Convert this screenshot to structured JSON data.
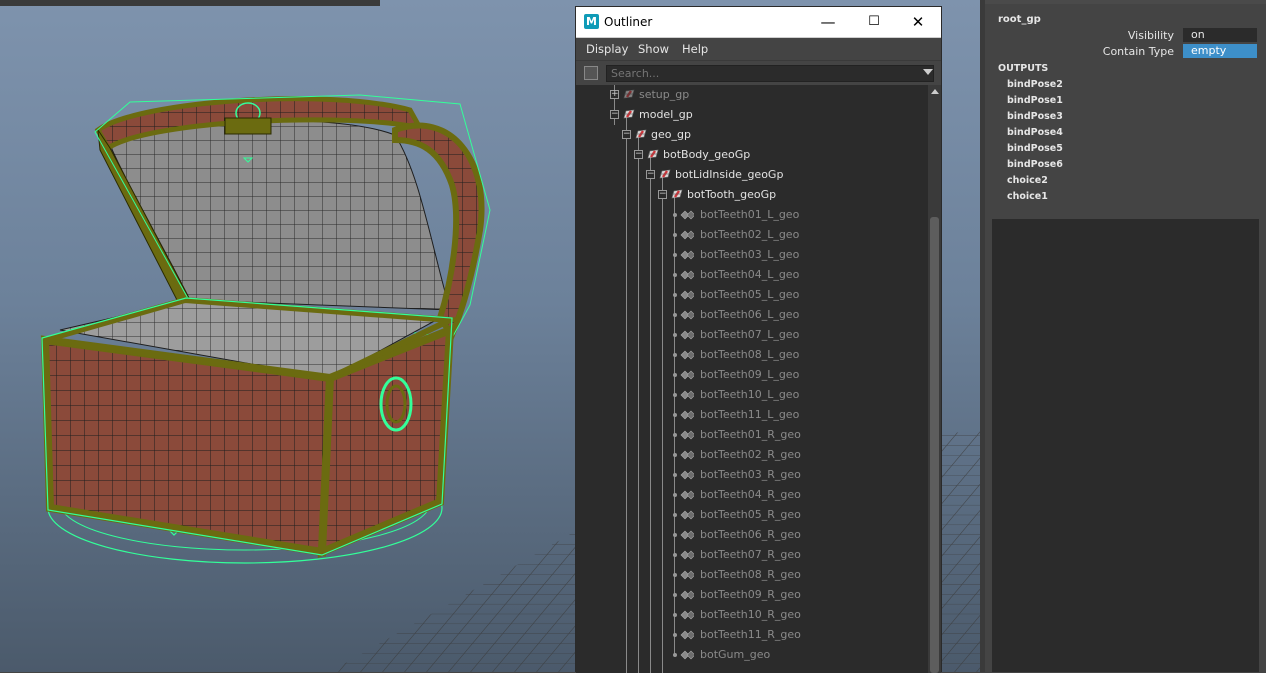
{
  "outliner": {
    "title": "Outliner",
    "window_controls": {
      "minimize": "—",
      "maximize": "☐",
      "close": "✕"
    },
    "menu": [
      "Display",
      "Show",
      "Help"
    ],
    "search_placeholder": "Search...",
    "tree": [
      {
        "label": "setup_gp",
        "type": "group",
        "depth": 0,
        "expander": "+",
        "state": "dim"
      },
      {
        "label": "model_gp",
        "type": "group",
        "depth": 0,
        "expander": "-",
        "state": "bright"
      },
      {
        "label": "geo_gp",
        "type": "group",
        "depth": 1,
        "expander": "-",
        "state": "bright"
      },
      {
        "label": "botBody_geoGp",
        "type": "group",
        "depth": 2,
        "expander": "-",
        "state": "bright"
      },
      {
        "label": "botLidInside_geoGp",
        "type": "group",
        "depth": 3,
        "expander": "-",
        "state": "bright"
      },
      {
        "label": "botTooth_geoGp",
        "type": "group",
        "depth": 4,
        "expander": "-",
        "state": "bright"
      },
      {
        "label": "botTeeth01_L_geo",
        "type": "mesh",
        "depth": 5,
        "state": "dim"
      },
      {
        "label": "botTeeth02_L_geo",
        "type": "mesh",
        "depth": 5,
        "state": "dim"
      },
      {
        "label": "botTeeth03_L_geo",
        "type": "mesh",
        "depth": 5,
        "state": "dim"
      },
      {
        "label": "botTeeth04_L_geo",
        "type": "mesh",
        "depth": 5,
        "state": "dim"
      },
      {
        "label": "botTeeth05_L_geo",
        "type": "mesh",
        "depth": 5,
        "state": "dim"
      },
      {
        "label": "botTeeth06_L_geo",
        "type": "mesh",
        "depth": 5,
        "state": "dim"
      },
      {
        "label": "botTeeth07_L_geo",
        "type": "mesh",
        "depth": 5,
        "state": "dim"
      },
      {
        "label": "botTeeth08_L_geo",
        "type": "mesh",
        "depth": 5,
        "state": "dim"
      },
      {
        "label": "botTeeth09_L_geo",
        "type": "mesh",
        "depth": 5,
        "state": "dim"
      },
      {
        "label": "botTeeth10_L_geo",
        "type": "mesh",
        "depth": 5,
        "state": "dim"
      },
      {
        "label": "botTeeth11_L_geo",
        "type": "mesh",
        "depth": 5,
        "state": "dim"
      },
      {
        "label": "botTeeth01_R_geo",
        "type": "mesh",
        "depth": 5,
        "state": "dim"
      },
      {
        "label": "botTeeth02_R_geo",
        "type": "mesh",
        "depth": 5,
        "state": "dim"
      },
      {
        "label": "botTeeth03_R_geo",
        "type": "mesh",
        "depth": 5,
        "state": "dim"
      },
      {
        "label": "botTeeth04_R_geo",
        "type": "mesh",
        "depth": 5,
        "state": "dim"
      },
      {
        "label": "botTeeth05_R_geo",
        "type": "mesh",
        "depth": 5,
        "state": "dim"
      },
      {
        "label": "botTeeth06_R_geo",
        "type": "mesh",
        "depth": 5,
        "state": "dim"
      },
      {
        "label": "botTeeth07_R_geo",
        "type": "mesh",
        "depth": 5,
        "state": "dim"
      },
      {
        "label": "botTeeth08_R_geo",
        "type": "mesh",
        "depth": 5,
        "state": "dim"
      },
      {
        "label": "botTeeth09_R_geo",
        "type": "mesh",
        "depth": 5,
        "state": "dim"
      },
      {
        "label": "botTeeth10_R_geo",
        "type": "mesh",
        "depth": 5,
        "state": "dim"
      },
      {
        "label": "botTeeth11_R_geo",
        "type": "mesh",
        "depth": 5,
        "state": "dim"
      },
      {
        "label": "botGum_geo",
        "type": "mesh",
        "depth": 5,
        "state": "dim"
      }
    ],
    "icons": {
      "group": "group-node-icon",
      "mesh": "mesh-node-icon"
    }
  },
  "channel_box": {
    "node_name": "root_gp",
    "attributes": [
      {
        "label": "Visibility",
        "value": "on",
        "highlight": false
      },
      {
        "label": "Contain Type",
        "value": "empty",
        "highlight": true
      }
    ],
    "outputs_title": "OUTPUTS",
    "outputs": [
      "bindPose2",
      "bindPose1",
      "bindPose3",
      "bindPose4",
      "bindPose5",
      "bindPose6",
      "choice2",
      "choice1"
    ]
  },
  "colors": {
    "selection_green": "#33ff99",
    "wood": "#8b4a3a",
    "trim": "#7a7a12",
    "highlight_blue": "#3d8fc9"
  }
}
